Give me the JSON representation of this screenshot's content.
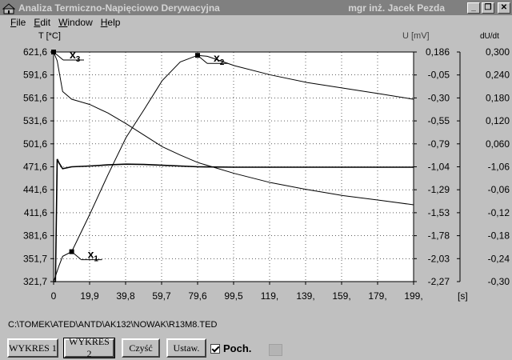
{
  "window": {
    "title": "Analiza Termiczno-Napięciowo Derywacyjna",
    "author": "mgr inż. Jacek Pezda",
    "controls": {
      "minimize": "_",
      "restore": "❐",
      "close": "✕"
    }
  },
  "menu": [
    {
      "label": "File",
      "underline": "F"
    },
    {
      "label": "Edit",
      "underline": "E"
    },
    {
      "label": "Window",
      "underline": "W"
    },
    {
      "label": "Help",
      "underline": "H"
    }
  ],
  "chart_data": {
    "type": "line",
    "left_axis": {
      "label": "T [*C]",
      "ticks": [
        "621,6",
        "591,6",
        "561,6",
        "531,6",
        "501,6",
        "471,6",
        "441,6",
        "411,6",
        "381,6",
        "351,7",
        "321,7"
      ],
      "range": [
        321.7,
        621.6
      ]
    },
    "mid_axis": {
      "label": "U [mV]",
      "ticks": [
        "0,186",
        "-0,05",
        "-0,30",
        "-0,55",
        "-0,79",
        "-1,04",
        "-1,29",
        "-1,53",
        "-1,78",
        "-2,03",
        "-2,27"
      ],
      "range": [
        -2.27,
        0.186
      ]
    },
    "right_axis": {
      "label": "dU/dt",
      "ticks": [
        "0,300",
        "0,240",
        "0,180",
        "0,120",
        "0,060",
        "-1,06",
        "-0,06",
        "-0,12",
        "-0,18",
        "-0,24",
        "-0,30"
      ],
      "range": [
        -0.3,
        0.3
      ]
    },
    "x_axis": {
      "label": "[s]",
      "ticks": [
        "0",
        "19,9",
        "39,8",
        "59,7",
        "79,6",
        "99,5",
        "119,",
        "139,",
        "159,",
        "179,",
        "199,"
      ],
      "range": [
        0,
        199
      ]
    },
    "grid": true,
    "series": [
      {
        "name": "T",
        "axis": "left",
        "points": [
          [
            0,
            621.6
          ],
          [
            2,
            610
          ],
          [
            5,
            570
          ],
          [
            10,
            560
          ],
          [
            20,
            553
          ],
          [
            30,
            542
          ],
          [
            40,
            528
          ],
          [
            50,
            513
          ],
          [
            60,
            498
          ],
          [
            70,
            487
          ],
          [
            80,
            477
          ],
          [
            100,
            463
          ],
          [
            120,
            451
          ],
          [
            140,
            442
          ],
          [
            160,
            434
          ],
          [
            180,
            428
          ],
          [
            199,
            422
          ]
        ]
      },
      {
        "name": "U",
        "axis": "mid",
        "points": [
          [
            0,
            -2.27
          ],
          [
            3,
            -2.1
          ],
          [
            5,
            -2.0
          ],
          [
            10,
            -1.95
          ],
          [
            20,
            -1.55
          ],
          [
            30,
            -1.13
          ],
          [
            40,
            -0.73
          ],
          [
            50,
            -0.43
          ],
          [
            60,
            -0.12
          ],
          [
            70,
            0.08
          ],
          [
            79.6,
            0.15
          ],
          [
            85,
            0.14
          ],
          [
            100,
            0.04
          ],
          [
            120,
            -0.06
          ],
          [
            140,
            -0.14
          ],
          [
            160,
            -0.2
          ],
          [
            180,
            -0.26
          ],
          [
            199,
            -0.32
          ]
        ]
      },
      {
        "name": "dU/dt",
        "axis": "right",
        "points": [
          [
            0,
            -0.3
          ],
          [
            1,
            -0.3
          ],
          [
            2,
            0.02
          ],
          [
            3,
            0.01
          ],
          [
            5,
            -0.005
          ],
          [
            10,
            0.0
          ],
          [
            20,
            0.002
          ],
          [
            30,
            0.005
          ],
          [
            40,
            0.007
          ],
          [
            50,
            0.006
          ],
          [
            60,
            0.004
          ],
          [
            80,
            0.0
          ],
          [
            100,
            -0.001
          ],
          [
            199,
            -0.001
          ]
        ]
      }
    ],
    "markers": [
      {
        "label": "x",
        "sub": "3",
        "x": 0,
        "y": 621.6,
        "axis": "left"
      },
      {
        "label": "x",
        "sub": "2",
        "x": 79.6,
        "y": 0.15,
        "axis": "mid"
      },
      {
        "label": "x",
        "sub": "1",
        "x": 10,
        "y": -1.95,
        "axis": "mid"
      }
    ]
  },
  "status": {
    "file_path": "C:\\TOMEK\\ATED\\ANTD\\AK132\\NOWAK\\R13M8.TED"
  },
  "buttons": {
    "wykres1": "WYKRES 1",
    "wykres2": "WYKRES 2",
    "czysc": "Czyść",
    "ustaw": "Ustaw."
  },
  "checkbox": {
    "label": "Poch.",
    "checked": true
  }
}
